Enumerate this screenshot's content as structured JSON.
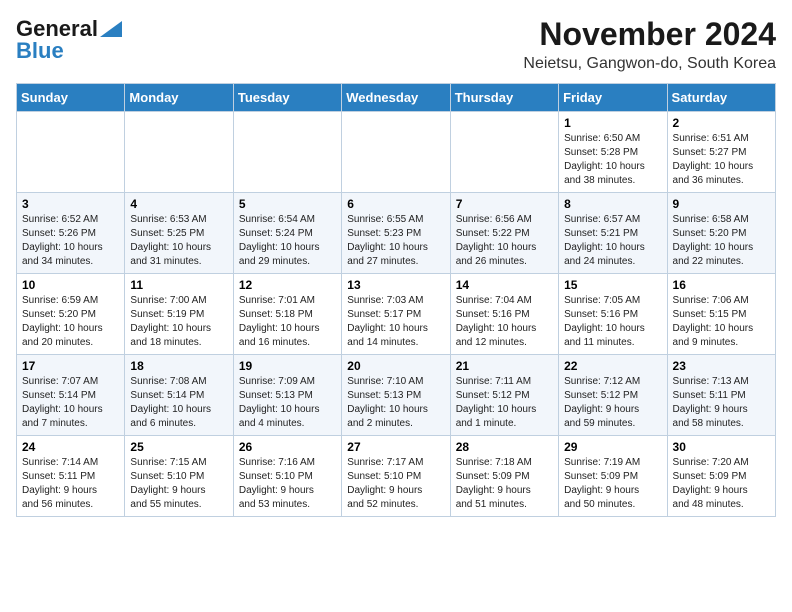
{
  "header": {
    "logo_general": "General",
    "logo_blue": "Blue",
    "month_year": "November 2024",
    "location": "Neietsu, Gangwon-do, South Korea"
  },
  "weekdays": [
    "Sunday",
    "Monday",
    "Tuesday",
    "Wednesday",
    "Thursday",
    "Friday",
    "Saturday"
  ],
  "weeks": [
    [
      {
        "day": "",
        "info": ""
      },
      {
        "day": "",
        "info": ""
      },
      {
        "day": "",
        "info": ""
      },
      {
        "day": "",
        "info": ""
      },
      {
        "day": "",
        "info": ""
      },
      {
        "day": "1",
        "info": "Sunrise: 6:50 AM\nSunset: 5:28 PM\nDaylight: 10 hours\nand 38 minutes."
      },
      {
        "day": "2",
        "info": "Sunrise: 6:51 AM\nSunset: 5:27 PM\nDaylight: 10 hours\nand 36 minutes."
      }
    ],
    [
      {
        "day": "3",
        "info": "Sunrise: 6:52 AM\nSunset: 5:26 PM\nDaylight: 10 hours\nand 34 minutes."
      },
      {
        "day": "4",
        "info": "Sunrise: 6:53 AM\nSunset: 5:25 PM\nDaylight: 10 hours\nand 31 minutes."
      },
      {
        "day": "5",
        "info": "Sunrise: 6:54 AM\nSunset: 5:24 PM\nDaylight: 10 hours\nand 29 minutes."
      },
      {
        "day": "6",
        "info": "Sunrise: 6:55 AM\nSunset: 5:23 PM\nDaylight: 10 hours\nand 27 minutes."
      },
      {
        "day": "7",
        "info": "Sunrise: 6:56 AM\nSunset: 5:22 PM\nDaylight: 10 hours\nand 26 minutes."
      },
      {
        "day": "8",
        "info": "Sunrise: 6:57 AM\nSunset: 5:21 PM\nDaylight: 10 hours\nand 24 minutes."
      },
      {
        "day": "9",
        "info": "Sunrise: 6:58 AM\nSunset: 5:20 PM\nDaylight: 10 hours\nand 22 minutes."
      }
    ],
    [
      {
        "day": "10",
        "info": "Sunrise: 6:59 AM\nSunset: 5:20 PM\nDaylight: 10 hours\nand 20 minutes."
      },
      {
        "day": "11",
        "info": "Sunrise: 7:00 AM\nSunset: 5:19 PM\nDaylight: 10 hours\nand 18 minutes."
      },
      {
        "day": "12",
        "info": "Sunrise: 7:01 AM\nSunset: 5:18 PM\nDaylight: 10 hours\nand 16 minutes."
      },
      {
        "day": "13",
        "info": "Sunrise: 7:03 AM\nSunset: 5:17 PM\nDaylight: 10 hours\nand 14 minutes."
      },
      {
        "day": "14",
        "info": "Sunrise: 7:04 AM\nSunset: 5:16 PM\nDaylight: 10 hours\nand 12 minutes."
      },
      {
        "day": "15",
        "info": "Sunrise: 7:05 AM\nSunset: 5:16 PM\nDaylight: 10 hours\nand 11 minutes."
      },
      {
        "day": "16",
        "info": "Sunrise: 7:06 AM\nSunset: 5:15 PM\nDaylight: 10 hours\nand 9 minutes."
      }
    ],
    [
      {
        "day": "17",
        "info": "Sunrise: 7:07 AM\nSunset: 5:14 PM\nDaylight: 10 hours\nand 7 minutes."
      },
      {
        "day": "18",
        "info": "Sunrise: 7:08 AM\nSunset: 5:14 PM\nDaylight: 10 hours\nand 6 minutes."
      },
      {
        "day": "19",
        "info": "Sunrise: 7:09 AM\nSunset: 5:13 PM\nDaylight: 10 hours\nand 4 minutes."
      },
      {
        "day": "20",
        "info": "Sunrise: 7:10 AM\nSunset: 5:13 PM\nDaylight: 10 hours\nand 2 minutes."
      },
      {
        "day": "21",
        "info": "Sunrise: 7:11 AM\nSunset: 5:12 PM\nDaylight: 10 hours\nand 1 minute."
      },
      {
        "day": "22",
        "info": "Sunrise: 7:12 AM\nSunset: 5:12 PM\nDaylight: 9 hours\nand 59 minutes."
      },
      {
        "day": "23",
        "info": "Sunrise: 7:13 AM\nSunset: 5:11 PM\nDaylight: 9 hours\nand 58 minutes."
      }
    ],
    [
      {
        "day": "24",
        "info": "Sunrise: 7:14 AM\nSunset: 5:11 PM\nDaylight: 9 hours\nand 56 minutes."
      },
      {
        "day": "25",
        "info": "Sunrise: 7:15 AM\nSunset: 5:10 PM\nDaylight: 9 hours\nand 55 minutes."
      },
      {
        "day": "26",
        "info": "Sunrise: 7:16 AM\nSunset: 5:10 PM\nDaylight: 9 hours\nand 53 minutes."
      },
      {
        "day": "27",
        "info": "Sunrise: 7:17 AM\nSunset: 5:10 PM\nDaylight: 9 hours\nand 52 minutes."
      },
      {
        "day": "28",
        "info": "Sunrise: 7:18 AM\nSunset: 5:09 PM\nDaylight: 9 hours\nand 51 minutes."
      },
      {
        "day": "29",
        "info": "Sunrise: 7:19 AM\nSunset: 5:09 PM\nDaylight: 9 hours\nand 50 minutes."
      },
      {
        "day": "30",
        "info": "Sunrise: 7:20 AM\nSunset: 5:09 PM\nDaylight: 9 hours\nand 48 minutes."
      }
    ]
  ]
}
